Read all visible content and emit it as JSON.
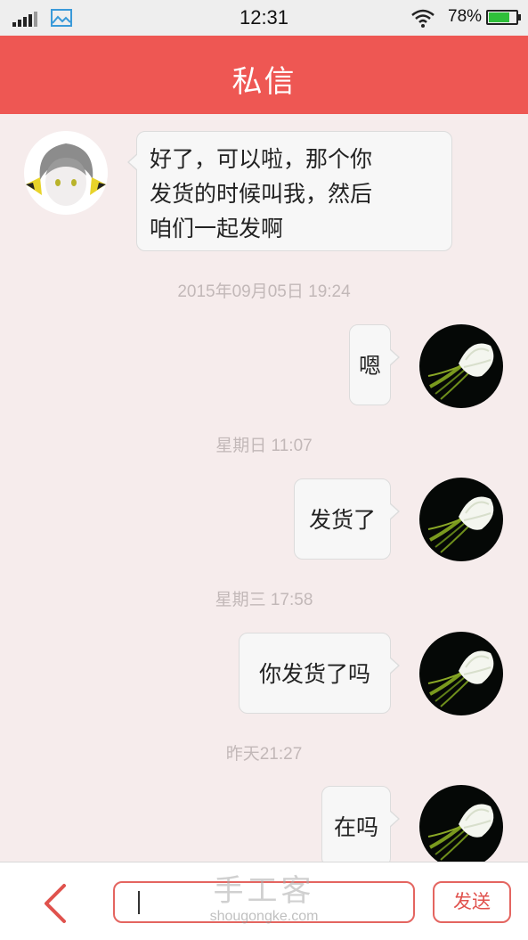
{
  "status_bar": {
    "time": "12:31",
    "battery_percent": "78%",
    "battery_level": 0.78,
    "icons": [
      "signal-icon",
      "image-icon",
      "wifi-icon",
      "battery-icon"
    ]
  },
  "header": {
    "title": "私信"
  },
  "messages": [
    {
      "side": "left",
      "text": "好了，可以啦，那个你\n发货的时候叫我，然后\n咱们一起发啊",
      "avatar": "anime-avatar"
    },
    {
      "timestamp": "2015年09月05日 19:24"
    },
    {
      "side": "right",
      "text": "嗯",
      "avatar": "flower-avatar"
    },
    {
      "timestamp": "星期日 11:07"
    },
    {
      "side": "right",
      "text": "发货了",
      "avatar": "flower-avatar"
    },
    {
      "timestamp": "星期三 17:58"
    },
    {
      "side": "right",
      "text": "你发货了吗",
      "avatar": "flower-avatar"
    },
    {
      "timestamp": "昨天21:27"
    },
    {
      "side": "right",
      "text": "在吗",
      "avatar": "flower-avatar"
    }
  ],
  "input": {
    "value": "",
    "placeholder": ""
  },
  "bottom_bar": {
    "back_icon": "chevron-left-icon",
    "send_label": "发送"
  },
  "watermark": {
    "main": "手工客",
    "sub": "shougongke.com"
  },
  "colors": {
    "accent": "#ee5753",
    "background": "#f6ecec",
    "bubble": "#f7f7f7",
    "battery": "#2fbf3a"
  }
}
